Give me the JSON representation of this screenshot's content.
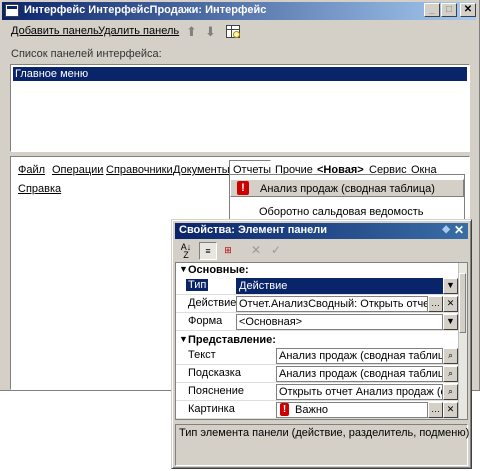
{
  "main_window": {
    "title": "Интерфейс ИнтерфейсПродажи: Интерфейс",
    "controls": {
      "minimize": "_",
      "maximize": "□",
      "close": "✕"
    }
  },
  "toolbar": {
    "add_panel": "Добавить панель",
    "delete_panel": "Удалить панель",
    "move_up_icon": "arrow-up-icon",
    "move_down_icon": "arrow-down-icon",
    "settings_icon": "panel-properties-icon"
  },
  "panel_list": {
    "label": "Список панелей интерфейса:",
    "items": [
      "Главное меню"
    ],
    "selected_index": 0
  },
  "menu_preview": {
    "items": [
      "Файл",
      "Операции",
      "Справочники",
      "Документы",
      "Отчеты",
      "Прочие",
      "<Новая>",
      "Сервис",
      "Окна",
      "Справка"
    ],
    "active": "Отчеты",
    "submenu": [
      "Анализ продаж (сводная таблица)",
      "Оборотно сальдовая ведомость"
    ]
  },
  "properties": {
    "title": "Свойства: Элемент панели",
    "sections": [
      {
        "name": "Основные:"
      },
      {
        "name": "Представление:"
      }
    ],
    "rows": {
      "type": {
        "label": "Тип",
        "value": "Действие"
      },
      "action": {
        "label": "Действие",
        "value": "Отчет.АнализСводный: Открыть отчет"
      },
      "form": {
        "label": "Форма",
        "value": "<Основная>"
      },
      "text": {
        "label": "Текст",
        "value": "Анализ продаж (сводная таблица)"
      },
      "tooltip": {
        "label": "Подсказка",
        "value": "Анализ продаж (сводная таблица)"
      },
      "hint": {
        "label": "Пояснение",
        "value": "Открыть отчет Анализ продаж (сво"
      },
      "picture": {
        "label": "Картинка",
        "value": "Важно"
      }
    },
    "description": "Тип элемента панели (действие, разделитель, подменю)"
  },
  "colors": {
    "title_bar": "#0a246a",
    "selection": "#0a246a",
    "face": "#d4d0c8",
    "warning": "#cc0000"
  }
}
